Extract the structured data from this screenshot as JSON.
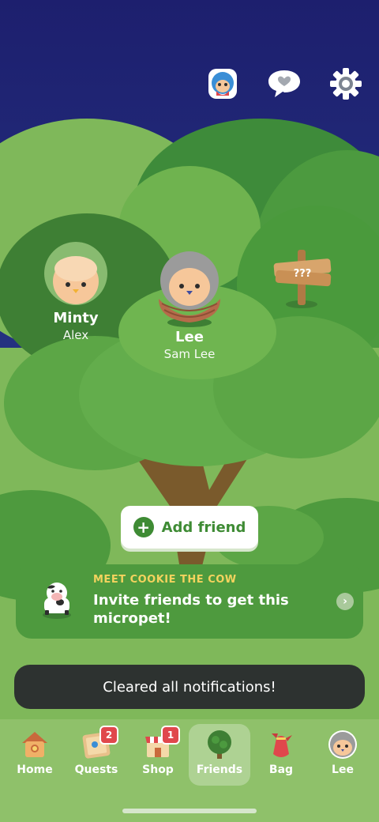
{
  "top_icons": [
    {
      "name": "friend-avatar-icon"
    },
    {
      "name": "heart-bubble-icon"
    },
    {
      "name": "gear-icon"
    }
  ],
  "pets": [
    {
      "name": "Minty",
      "owner": "Alex"
    },
    {
      "name": "Lee",
      "owner": "Sam Lee"
    }
  ],
  "signpost": {
    "text": "???"
  },
  "add_friend": {
    "label": "Add friend"
  },
  "promo": {
    "eyebrow": "MEET COOKIE THE COW",
    "message": "Invite friends to get this micropet!"
  },
  "toast": {
    "text": "Cleared all notifications!"
  },
  "tabs": [
    {
      "label": "Home",
      "icon": "birdhouse-icon",
      "badge": null,
      "active": false
    },
    {
      "label": "Quests",
      "icon": "quest-map-icon",
      "badge": "2",
      "active": false
    },
    {
      "label": "Shop",
      "icon": "shop-icon",
      "badge": "1",
      "active": false
    },
    {
      "label": "Friends",
      "icon": "tree-icon",
      "badge": null,
      "active": true
    },
    {
      "label": "Bag",
      "icon": "bag-icon",
      "badge": null,
      "active": false
    },
    {
      "label": "Lee",
      "icon": "bird-avatar-icon",
      "badge": null,
      "active": false
    }
  ]
}
